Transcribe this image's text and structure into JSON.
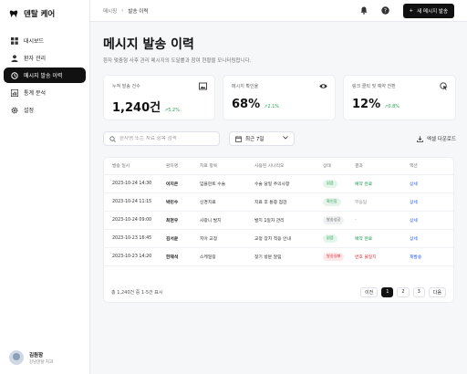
{
  "app": {
    "name": "덴탈 케어"
  },
  "sidebar": {
    "items": [
      {
        "label": "대시보드",
        "icon": "dashboard-icon"
      },
      {
        "label": "환자 관리",
        "icon": "person-icon"
      },
      {
        "label": "메시지 발송 이력",
        "icon": "history-icon",
        "active": true
      },
      {
        "label": "통계 분석",
        "icon": "chart-icon"
      },
      {
        "label": "설정",
        "icon": "gear-icon"
      }
    ]
  },
  "user": {
    "name": "김원장",
    "role": "강남덴탈 치과"
  },
  "header": {
    "breadcrumb": [
      "메시징",
      "발송 이력"
    ],
    "new_message_label": "새 메시지 발송"
  },
  "page": {
    "title": "메시지 발송 이력",
    "subtitle": "환자 맞춤형 사후 관리 메시지의 도달률과 참여 현황을 모니터링합니다."
  },
  "stats": [
    {
      "label": "누적 발송 건수",
      "value": "1,240건",
      "delta": "↗5.2%",
      "icon": "image-icon"
    },
    {
      "label": "메시지 확인율",
      "value": "68%",
      "delta": "↗2.1%",
      "icon": "eye-icon"
    },
    {
      "label": "링크 클릭 및 예약 전환",
      "value": "12%",
      "delta": "↗0.8%",
      "icon": "cursor-click-icon"
    }
  ],
  "filters": {
    "search_placeholder": "환자명 또는 치료 항목 검색",
    "period": "최근 7일",
    "export_label": "엑셀 다운로드"
  },
  "table": {
    "columns": [
      "발송 일시",
      "환자명",
      "치료 항목",
      "사용된 시나리오",
      "상태",
      "결과",
      "액션"
    ],
    "rows": [
      {
        "date": "2023-10-24 14:30",
        "patient": "이지은",
        "treatment": "임플란트 수술",
        "scenario": "수술 당일 주의사항",
        "status": "읽음",
        "result": "예약 완료",
        "action": "상세"
      },
      {
        "date": "2023-10-24 11:15",
        "patient": "박민수",
        "treatment": "신경치료",
        "scenario": "치료 후 통증 점검",
        "status": "확인함",
        "result": "무응답",
        "action": "상세"
      },
      {
        "date": "2023-10-24 09:00",
        "patient": "최현우",
        "treatment": "사랑니 발치",
        "scenario": "발치 1일차 관리",
        "status": "발송성공",
        "result": "-",
        "action": "상세"
      },
      {
        "date": "2023-10-23 16:45",
        "patient": "김서윤",
        "treatment": "치아 교정",
        "scenario": "교정 장치 적응 안내",
        "status": "읽음",
        "result": "예약 완료",
        "action": "상세"
      },
      {
        "date": "2023-10-23 14:20",
        "patient": "한재석",
        "treatment": "스케일링",
        "scenario": "정기 방문 알림",
        "status": "발송실패",
        "result": "번호 불일치",
        "action": "재발송"
      }
    ],
    "status_colors": {
      "읽음": {
        "bg": "#e4f5ea",
        "fg": "#1f9d55"
      },
      "확인함": {
        "bg": "#e6f4ea",
        "fg": "#2f9e5a"
      },
      "발송성공": {
        "bg": "#eef0f3",
        "fg": "#666666"
      },
      "발송실패": {
        "bg": "#fde7e8",
        "fg": "#d9363e"
      }
    },
    "summary": "총 1,240건 중 1-5건 표시",
    "pagination": {
      "prev": "이전",
      "pages": [
        "1",
        "2",
        "3"
      ],
      "current": "1",
      "next": "다음"
    }
  }
}
